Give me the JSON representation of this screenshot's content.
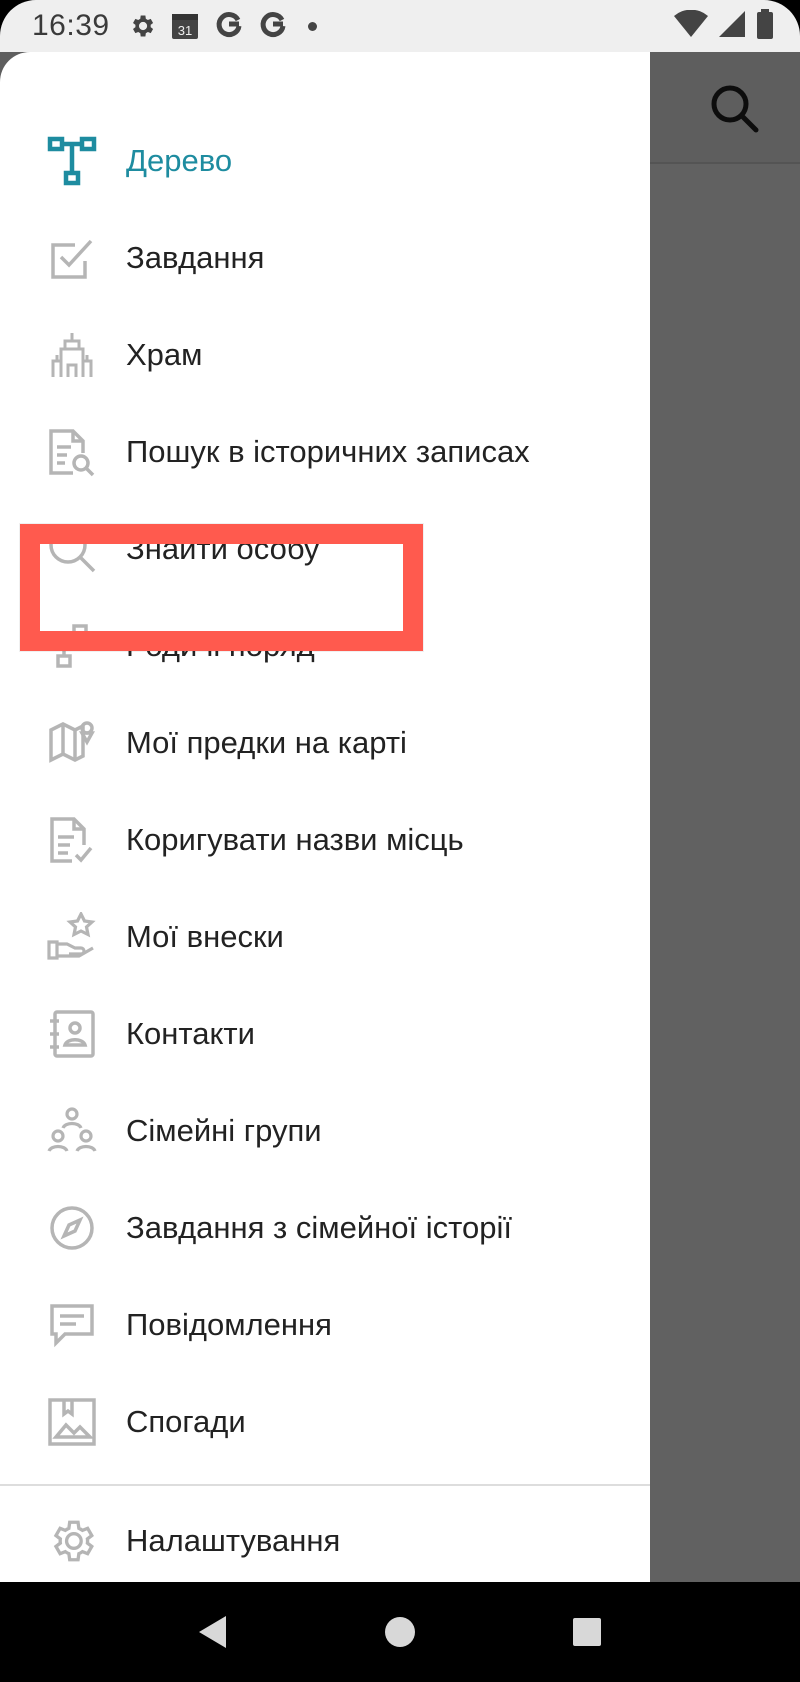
{
  "status_bar": {
    "time": "16:39",
    "calendar_day": "31",
    "notification_icons": [
      "gear-icon",
      "calendar-icon",
      "google-icon",
      "google-icon",
      "dot-icon"
    ],
    "right_icons": [
      "wifi-icon",
      "cell-signal-icon",
      "battery-icon"
    ]
  },
  "drawer": {
    "items": [
      {
        "label": "Дерево",
        "icon": "tree-icon",
        "active": true
      },
      {
        "label": "Завдання",
        "icon": "tasks-checkbox-icon"
      },
      {
        "label": "Храм",
        "icon": "temple-icon"
      },
      {
        "label": "Пошук в історичних записах",
        "icon": "records-search-icon"
      },
      {
        "label": "Знайти особу",
        "icon": "search-icon"
      },
      {
        "label": "Родичі поряд",
        "icon": "relatives-nearby-icon"
      },
      {
        "label": "Мої предки на карті",
        "icon": "map-pin-icon"
      },
      {
        "label": "Коригувати назви місць",
        "icon": "document-check-icon"
      },
      {
        "label": "Мої внески",
        "icon": "hand-star-icon"
      },
      {
        "label": "Контакти",
        "icon": "contacts-book-icon"
      },
      {
        "label": "Сімейні групи",
        "icon": "family-group-icon"
      },
      {
        "label": "Завдання з сімейної історії",
        "icon": "compass-icon"
      },
      {
        "label": "Повідомлення",
        "icon": "message-icon"
      },
      {
        "label": "Спогади",
        "icon": "memories-photo-icon"
      }
    ],
    "settings": {
      "label": "Налаштування",
      "icon": "gear-icon"
    }
  },
  "colors": {
    "accent": "#1e8ca0",
    "icon_gray": "#b5b5b5",
    "highlight": "#ff5a4e",
    "scrim": "#5f5f5f"
  },
  "highlighted_item": "Родичі поряд",
  "nav_bar": [
    "back-icon",
    "home-icon",
    "recents-icon"
  ]
}
